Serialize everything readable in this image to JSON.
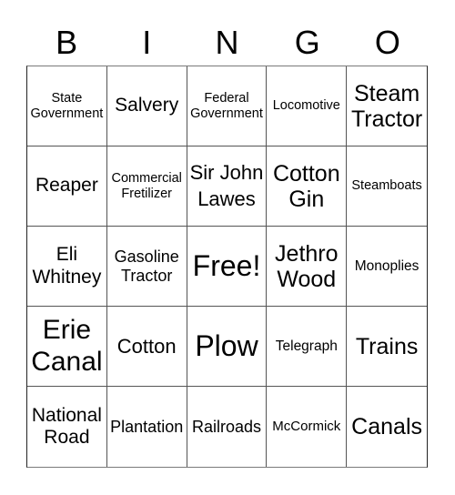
{
  "header": {
    "letters": [
      "B",
      "I",
      "N",
      "G",
      "O"
    ]
  },
  "cells": [
    [
      "State Government",
      "Salvery",
      "Federal Government",
      "Locomotive",
      "Steam Tractor"
    ],
    [
      "Reaper",
      "Commercial Fretilizer",
      "Sir John Lawes",
      "Cotton Gin",
      "Steamboats"
    ],
    [
      "Eli Whitney",
      "Gasoline Tractor",
      "Free!",
      "Jethro Wood",
      "Monoplies"
    ],
    [
      "Erie Canal",
      "Cotton",
      "Plow",
      "Telegraph",
      "Trains"
    ],
    [
      "National Road",
      "Plantation",
      "Railroads",
      "McCormick",
      "Canals"
    ]
  ],
  "free_space": "Free!"
}
